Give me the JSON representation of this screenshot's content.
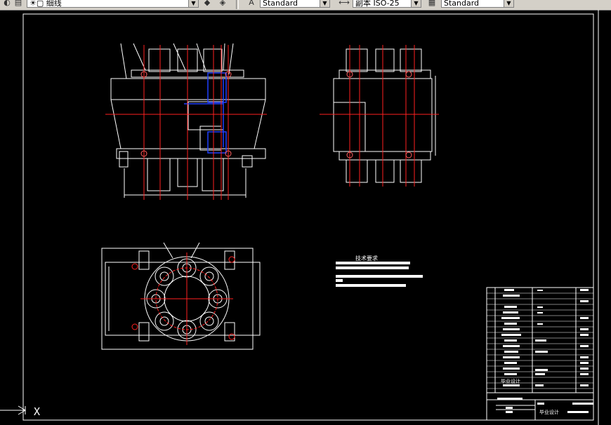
{
  "toolbar": {
    "layer_name": "细线",
    "text_style": "Standard",
    "dim_style": "副本 ISO-25",
    "table_style": "Standard",
    "layer_icon": "layer-bulb-icon",
    "style_icons": [
      "text-style-icon",
      "dim-style-icon",
      "table-style-icon"
    ]
  },
  "drawing": {
    "tech_requirements_title": "技术要求",
    "title_block": {
      "designer_label": "毕业设计",
      "sub_label": "毕业设计"
    },
    "ucs_axis_label": "X"
  },
  "colors": {
    "background": "#000000",
    "outline": "#ffffff",
    "centerline": "#ff0000",
    "hidden": "#0000ff"
  }
}
